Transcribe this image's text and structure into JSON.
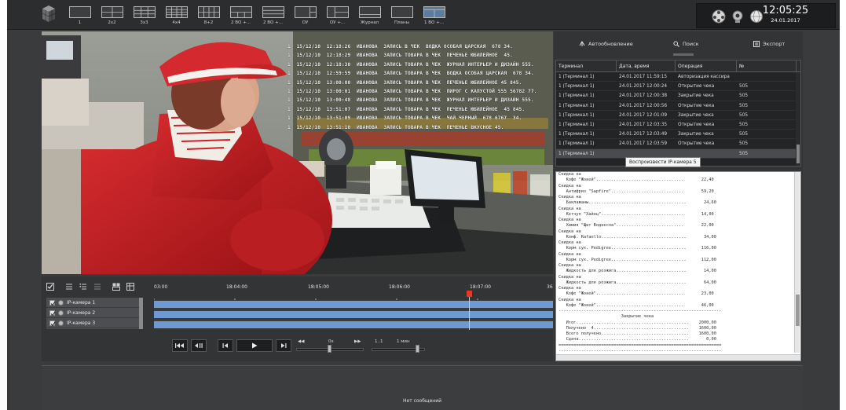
{
  "toolbar": {
    "layouts": [
      {
        "label": "1",
        "grid": "1"
      },
      {
        "label": "2x2",
        "grid": "2x2"
      },
      {
        "label": "3x3",
        "grid": "3x3"
      },
      {
        "label": "4x4",
        "grid": "4x4"
      },
      {
        "label": "8+2",
        "grid": "8+2"
      },
      {
        "label": "2 ВО +...",
        "grid": "2v"
      },
      {
        "label": "2 ВО +...",
        "grid": "2h"
      },
      {
        "label": "ОУ",
        "grid": "ou"
      },
      {
        "label": "ОУ +...",
        "grid": "ou2"
      },
      {
        "label": "Журнал",
        "grid": "journal"
      },
      {
        "label": "Планы",
        "grid": "plans"
      },
      {
        "label": "1 ВО +...",
        "grid": "active"
      }
    ],
    "time": "12:05:25",
    "date": "24.01.2017"
  },
  "video": {
    "overlay_lines": [
      "1  15/12/10  12:18:26  ИВАНОВА  ЗАПИСЬ В ЧЕК  ВОДКА ОСОБАЯ ЦАРСКАЯ  678 34.",
      "1  15/12/10  12:18:29  ИВАНОВА  ЗАПИСЬ ТОВАРА В ЧЕК  ПЕЧЕНЬЕ ЮБИЛЕЙНОЕ  45.",
      "1  15/12/10  12:18:30  ИВАНОВА  ЗАПИСЬ ТОВАРА В ЧЕК  ЖУРНАЛ ИНТЕРЬЕР И ДИЗАЙН 555.",
      "1  15/12/10  12:59:59  ИВАНОВА  ЗАПИСЬ ТОВАРА В ЧЕК  ВОДКА ОСОБАЯ ЦАРСКАЯ  678 34.",
      "1  15/12/10  13:00:00  ИВАНОВА  ЗАПИСЬ ТОВАРА В ЧЕК  ПЕЧЕНЬЕ ЮБИЛЕЙНОЕ 45 845.",
      "1  15/12/10  13:00:01  ИВАНОВА  ЗАПИСЬ ТОВАРА В ЧЕК  ПИРОГ С КАПУСТОЙ 555 56782 77.",
      "1  15/12/10  13:00:48  ИВАНОВА  ЗАПИСЬ ТОВАРА В ЧЕК  ЖУРНАЛ ИНТЕРЬЕР И ДИЗАЙН 555.",
      "1  15/12/10  13:51:07  ИВАНОВА  ЗАПИСЬ ТОВАРА В ЧЕК  ПЕЧЕНЬЕ ЮБИЛЕЙНОЕ  45 845.",
      "1  15/12/10  13:51:09  ИВАНОВА  ЗАПИСЬ ТОВАРА В ЧЕК  ЧАЙ ЧЕРНЫЙ  678 6767  34.",
      "1  15/12/10  13:51:10  ИВАНОВА  ЗАПИСЬ ТОВАРА В ЧЕК  ПЕЧЕНЬЕ ВКУСНОЕ 45."
    ]
  },
  "panel": {
    "autoupdate": "Автообновление",
    "search": "Поиск",
    "export": "Экспорт",
    "columns": [
      "Терминал",
      "Дата, время",
      "Операция",
      "№"
    ],
    "rows": [
      {
        "terminal": "1 (Терминал 1)",
        "datetime": "24.01.2017 11:59:15",
        "operation": "Авторизация кассира",
        "num": ""
      },
      {
        "terminal": "1 (Терминал 1)",
        "datetime": "24.01.2017 12:00:24",
        "operation": "Открытие чека",
        "num": "505"
      },
      {
        "terminal": "1 (Терминал 1)",
        "datetime": "24.01.2017 12:00:38",
        "operation": "Закрытие чека",
        "num": "505"
      },
      {
        "terminal": "1 (Терминал 1)",
        "datetime": "24.01.2017 12:00:56",
        "operation": "Открытие чека",
        "num": "505"
      },
      {
        "terminal": "1 (Терминал 1)",
        "datetime": "24.01.2017 12:01:09",
        "operation": "Закрытие чека",
        "num": "505"
      },
      {
        "terminal": "1 (Терминал 1)",
        "datetime": "24.01.2017 12:03:35",
        "operation": "Открытие чека",
        "num": "505"
      },
      {
        "terminal": "1 (Терминал 1)",
        "datetime": "24.01.2017 12:03:49",
        "operation": "Закрытие чека",
        "num": "505"
      },
      {
        "terminal": "1 (Терминал 1)",
        "datetime": "24.01.2017 12:03:59",
        "operation": "Открытие чека",
        "num": "505"
      },
      {
        "terminal": "1 (Терминал 1)",
        "datetime": "",
        "operation": "",
        "num": "505"
      }
    ],
    "tooltip": "Воспроизвести IP-камера 5",
    "receipt_lines": [
      "Скидка на",
      "   Кофе \"Жокей\"...................................       22,40",
      "Скидка на",
      "   Антифриз \"Sapfire\".............................       59,20",
      "Скидка на",
      "   Баклажаны.......................................       24,60",
      "Скидка на",
      "   Кетчуп \"Хайнц\".................................       14,00",
      "Скидка на",
      "   Химия \"Щит Воднесла\"...........................       22,00",
      "Скидка на",
      "   Конф. Rafaello..................................       34,00",
      "Скидка на",
      "   Корм сух. Pedigree..............................      116,00",
      "Скидка на",
      "   Корм сух. Pedigree..............................      112,00",
      "Скидка на",
      "   Жидкость для розжига............................       14,00",
      "Скидка на",
      "   Жидкость для розжига............................       64,00",
      "Скидка на",
      "   Кофе \"Жокей\"...................................       23,00",
      "Скидка на",
      "   Кофе \"Жокей\"...................................       46,00",
      "-----------------------------------------------------------------",
      "                         Закрытие чека",
      "   Итог.............................................    2000,00",
      "   Получено  4......................................    1600,00",
      "   Всего получено...................................    1600,00",
      "   Сдача............................................       0,00",
      "=================================================================",
      "-----------------------------------------------------------------"
    ]
  },
  "timeline": {
    "ticks": [
      "03:00",
      "18:04:00",
      "18:05:00",
      "18:06:00",
      "18:07:00",
      "36"
    ],
    "cameras": [
      "IP-камера 1",
      "IP-камера 2",
      "IP-камера 3"
    ],
    "speed_label": "0x",
    "zoom_left": "1..1",
    "zoom_label": "1 мин"
  },
  "messages": {
    "text": "Нет сообщений"
  }
}
